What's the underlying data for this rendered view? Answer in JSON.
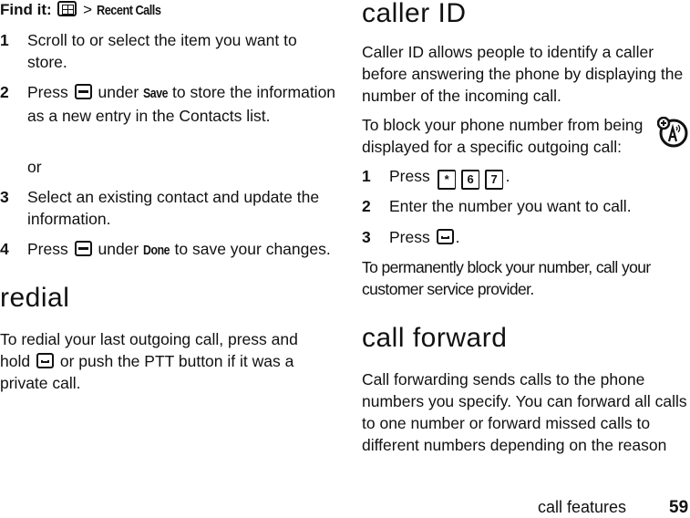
{
  "left_column": {
    "find_it": {
      "label": "Find it:",
      "icon": "menu-key-icon",
      "separator": ">",
      "path": "Recent Calls"
    },
    "steps": [
      {
        "num": "1",
        "text": "Scroll to or select the item you want to store."
      },
      {
        "num": "2",
        "pre": "Press",
        "icon": "soft-key-icon",
        "mid": "under",
        "key_label": "Save",
        "post": "to store the information as a new entry in the Contacts list."
      },
      {
        "or": "or"
      },
      {
        "num": "3",
        "text": "Select an existing contact and update the information."
      },
      {
        "num": "4",
        "pre": "Press",
        "icon": "soft-key-icon",
        "mid": "under",
        "key_label": "Done",
        "post": "to save your changes."
      }
    ],
    "redial": {
      "heading": "redial",
      "text_pre": "To redial your last outgoing call, press and hold",
      "icon": "send-key-icon",
      "text_post": "or push the PTT button if it was a private call."
    }
  },
  "right_column": {
    "caller_id": {
      "heading": "caller ID",
      "intro": "Caller ID allows people to identify a caller before answering the phone by displaying the number of the incoming call.",
      "block_intro": "To block your phone number from being displayed for a specific outgoing call:",
      "network_icon": "network-feature-icon",
      "steps": [
        {
          "num": "1",
          "pre": "Press",
          "keys": [
            "*",
            "6",
            "7"
          ],
          "post": "."
        },
        {
          "num": "2",
          "text": "Enter the number you want to call."
        },
        {
          "num": "3",
          "pre": "Press",
          "icon": "send-key-icon",
          "post": "."
        }
      ],
      "permanent": "To permanently block your number, call your customer service provider."
    },
    "call_forward": {
      "heading": "call forward",
      "text": "Call forwarding sends calls to the phone numbers you specify. You can forward all calls to one number or forward missed calls to different numbers depending on the reason"
    }
  },
  "footer": {
    "section": "call features",
    "page": "59"
  }
}
